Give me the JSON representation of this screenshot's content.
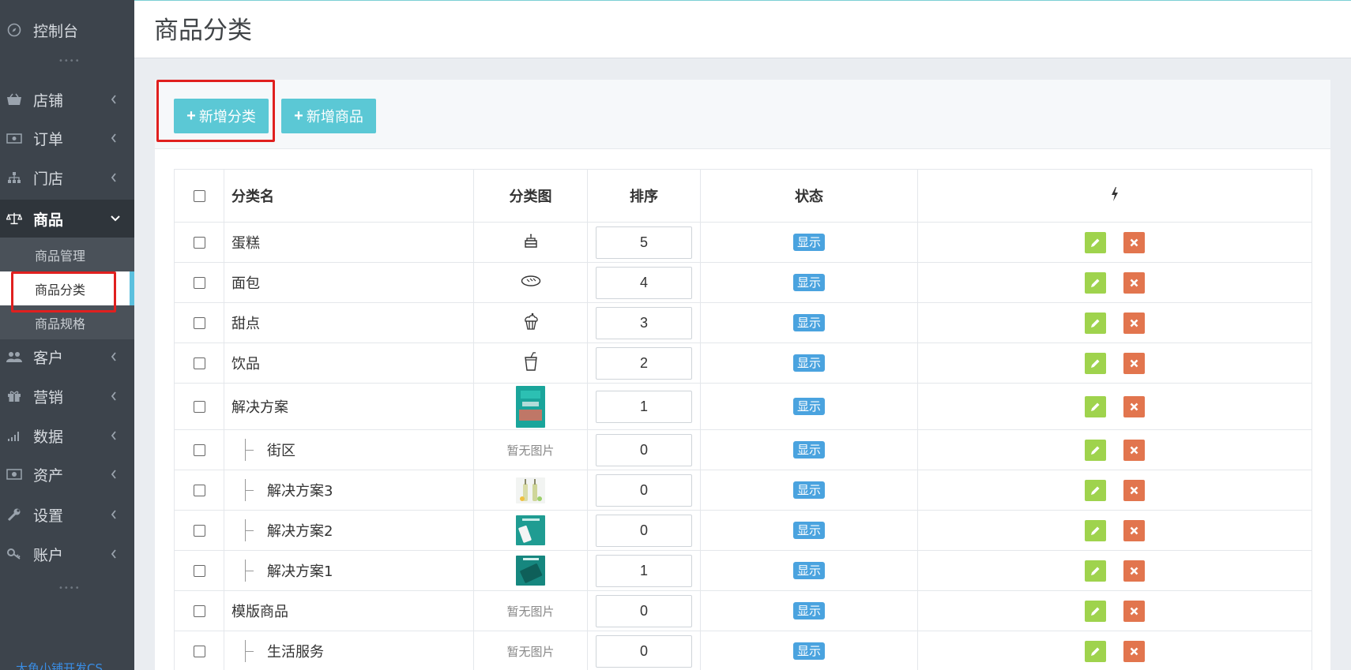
{
  "sidebar": {
    "dashboard": "控制台",
    "menu": [
      {
        "label": "店铺",
        "icon": "basket-icon"
      },
      {
        "label": "订单",
        "icon": "money-icon"
      },
      {
        "label": "门店",
        "icon": "sitemap-icon"
      },
      {
        "label": "商品",
        "icon": "balance-scale-icon"
      },
      {
        "label": "客户",
        "icon": "users-icon"
      },
      {
        "label": "营销",
        "icon": "gift-icon"
      },
      {
        "label": "数据",
        "icon": "bar-signal-icon"
      },
      {
        "label": "资产",
        "icon": "cash-icon"
      },
      {
        "label": "设置",
        "icon": "wrench-icon"
      },
      {
        "label": "账户",
        "icon": "key-icon"
      }
    ],
    "submenu": [
      "商品管理",
      "商品分类",
      "商品规格"
    ],
    "footer": "大鱼小铺开发CS"
  },
  "header": {
    "title": "商品分类"
  },
  "toolbar": {
    "add_category": "新增分类",
    "add_product": "新增商品"
  },
  "table": {
    "headers": {
      "name": "分类名",
      "image": "分类图",
      "sort": "排序",
      "status": "状态",
      "action_icon": "bolt-icon"
    },
    "rows": [
      {
        "name": "蛋糕",
        "child": false,
        "image": "cake-icon",
        "sort": "5",
        "status": "显示"
      },
      {
        "name": "面包",
        "child": false,
        "image": "bread-icon",
        "sort": "4",
        "status": "显示"
      },
      {
        "name": "甜点",
        "child": false,
        "image": "cupcake-icon",
        "sort": "3",
        "status": "显示"
      },
      {
        "name": "饮品",
        "child": false,
        "image": "drink-cup-icon",
        "sort": "2",
        "status": "显示"
      },
      {
        "name": "解决方案",
        "child": false,
        "image": "thumb-teal-poster",
        "sort": "1",
        "status": "显示"
      },
      {
        "name": "街区",
        "child": true,
        "image": "none",
        "noimg": "暂无图片",
        "sort": "0",
        "status": "显示"
      },
      {
        "name": "解决方案3",
        "child": true,
        "image": "thumb-bottles",
        "sort": "0",
        "status": "显示"
      },
      {
        "name": "解决方案2",
        "child": true,
        "image": "thumb-teal-phone",
        "sort": "0",
        "status": "显示"
      },
      {
        "name": "解决方案1",
        "child": true,
        "image": "thumb-teal-tablet",
        "sort": "1",
        "status": "显示"
      },
      {
        "name": "模版商品",
        "child": false,
        "image": "none",
        "noimg": "暂无图片",
        "sort": "0",
        "status": "显示"
      },
      {
        "name": "生活服务",
        "child": true,
        "image": "none",
        "noimg": "暂无图片",
        "sort": "0",
        "status": "显示"
      }
    ]
  },
  "colors": {
    "sidebar_bg": "#3d444c",
    "accent": "#5bc8d5",
    "badge": "#4aa3df",
    "edit": "#9fd34d",
    "delete": "#e2754e",
    "highlight": "#e0201f"
  }
}
